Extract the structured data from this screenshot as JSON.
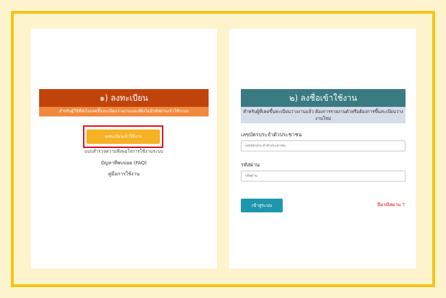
{
  "colors": {
    "page_bg": "#fdf3cc",
    "frame_border": "#f7c20f",
    "register_header": "#c1430c",
    "register_sub": "#f08a3e",
    "register_button": "#f7b125",
    "highlight_box": "#e30613",
    "login_header": "#3a7b82",
    "login_sub": "#d6dce9",
    "login_button": "#1c97ad",
    "forgot_link": "#e30613"
  },
  "register": {
    "title": "๑) ลงทะเบียน",
    "description": "สำหรับผู้ใช้ที่ยังไม่เคยขึ้นทะเบียนว่างงานและที่ยังไม่มีรหัสผ่านเข้าใช้ระบบ",
    "button_label": "ลงทะเบียนเข้าใช้งาน",
    "links": {
      "survey": "แบบสำรวจความพึงพอใจการใช้งานระบบ",
      "faq": "ปัญหาที่พบบ่อย (FAQ)",
      "manual": "คู่มือการใช้งาน"
    }
  },
  "login": {
    "title": "๒) ลงชื่อเข้าใช้งาน",
    "description": "สำหรับผู้ที่เคยขึ้นทะเบียนว่างงานแล้ว ต้องการรายงานตัวหรือต้องการขึ้นทะเบียนว่างงานใหม่",
    "id_label": "เลขบัตรประจำตัวประชาชน",
    "id_placeholder": "เลขบัตรประจำตัวประชาชน",
    "password_label": "รหัสผ่าน",
    "password_placeholder": "รหัสผ่าน",
    "submit_label": "เข้าสู่ระบบ",
    "forgot_label": "ลืมรหัสผ่าน ?"
  }
}
